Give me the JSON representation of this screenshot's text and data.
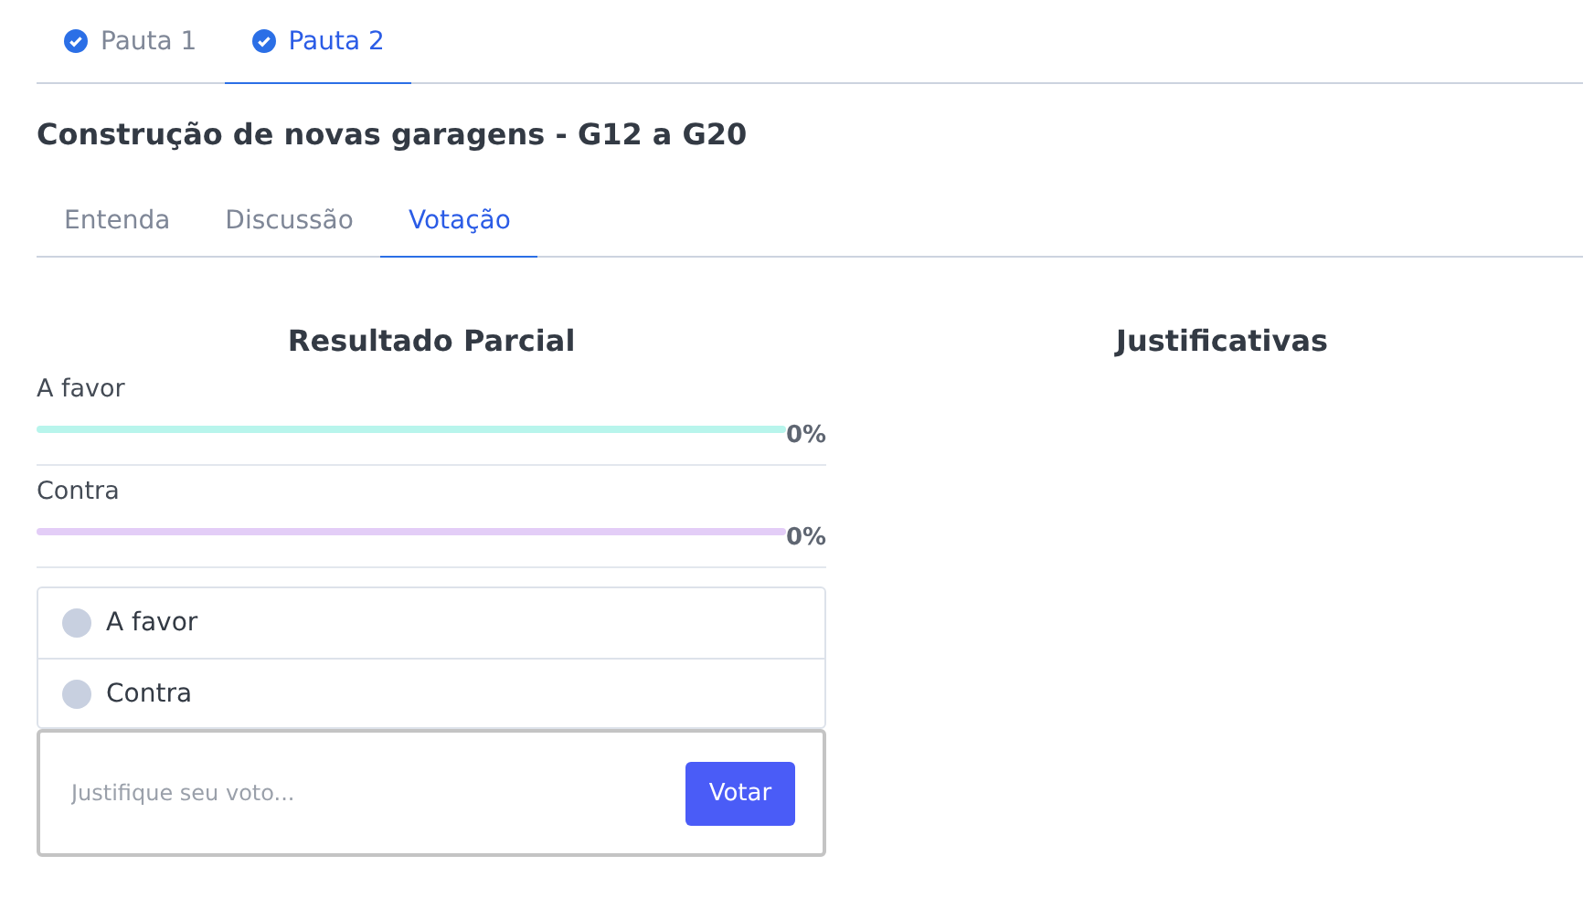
{
  "agenda_tabs": [
    {
      "label": "Pauta 1",
      "selected": false,
      "done": true
    },
    {
      "label": "Pauta 2",
      "selected": true,
      "done": true
    }
  ],
  "title": "Construção de novas garagens - G12 a G20",
  "section_tabs": [
    {
      "label": "Entenda",
      "selected": false
    },
    {
      "label": "Discussão",
      "selected": false
    },
    {
      "label": "Votação",
      "selected": true
    }
  ],
  "results": {
    "heading": "Resultado Parcial",
    "items": [
      {
        "label": "A favor",
        "level": 0,
        "reading": "0%",
        "color": "#b8f5ec"
      },
      {
        "label": "Contra",
        "level": 0,
        "reading": "0%",
        "color": "#e3cdf7"
      }
    ]
  },
  "vote_options": [
    {
      "label": "A favor",
      "selected": false
    },
    {
      "label": "Contra",
      "selected": false
    }
  ],
  "justification": {
    "placeholder": "Justifique seu voto..."
  },
  "submit": "Votar",
  "justifications": {
    "heading": "Justificativas"
  }
}
